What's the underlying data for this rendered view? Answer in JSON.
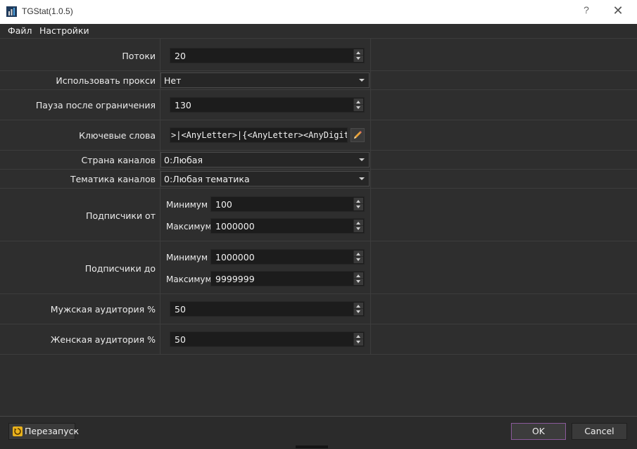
{
  "window": {
    "title": "TGStat(1.0.5)",
    "help_glyph": "?",
    "close_glyph": "✕"
  },
  "menu": [
    "Файл",
    "Настройки"
  ],
  "form": {
    "threads": {
      "label": "Потоки",
      "value": "20"
    },
    "use_proxy": {
      "label": "Использовать прокси",
      "value": "Нет"
    },
    "pause": {
      "label": "Пауза после ограничения",
      "value": "130"
    },
    "keywords": {
      "label": "Ключевые слова",
      "value": ">|<AnyLetter>|{<AnyLetter><AnyDigit>}}"
    },
    "country": {
      "label": "Страна каналов",
      "value": "0:Любая"
    },
    "topic": {
      "label": "Тематика каналов",
      "value": "0:Любая тематика"
    },
    "subs_from": {
      "label": "Подписчики от",
      "min_label": "Минимум",
      "min": "100",
      "max_label": "Максимум",
      "max": "1000000"
    },
    "subs_to": {
      "label": "Подписчики до",
      "min_label": "Минимум",
      "min": "1000000",
      "max_label": "Максимум",
      "max": "9999999"
    },
    "male": {
      "label": "Мужская аудитория %",
      "value": "50"
    },
    "female": {
      "label": "Женская аудитория %",
      "value": "50"
    }
  },
  "buttons": {
    "restart": "Перезапуск",
    "ok": "OK",
    "cancel": "Cancel"
  },
  "colors": {
    "background": "#2f2f2f",
    "field": "#1c1c1c",
    "ok_border": "#8a5a9a",
    "restart_icon": "#e9b21c"
  },
  "icons": [
    "app-icon",
    "help-icon",
    "close-icon",
    "pencil-icon",
    "restart-icon"
  ]
}
